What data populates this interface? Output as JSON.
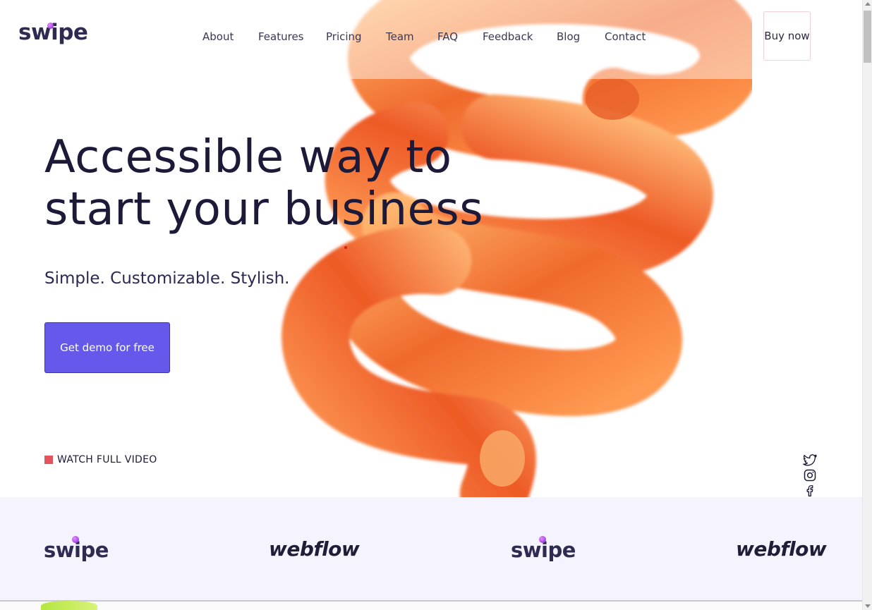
{
  "header": {
    "logo": "swipe",
    "nav": [
      "About",
      "Features",
      "Pricing",
      "Team",
      "FAQ",
      "Feedback",
      "Blog",
      "Contact"
    ],
    "buy_now": "Buy now"
  },
  "hero": {
    "headline_line1": "Accessible way to",
    "headline_line2": "start your business",
    "subtitle": "Simple. Customizable. Stylish.",
    "cta_label": "Get demo for free",
    "watch_video": "WATCH FULL VIDEO"
  },
  "social": [
    "twitter-icon",
    "instagram-icon",
    "facebook-icon"
  ],
  "logo_strip": [
    "swipe",
    "webflow",
    "swipe",
    "webflow"
  ],
  "colors": {
    "accent": "#6459ea",
    "text_dark": "#1c1a38",
    "spiral_orange": "#f0732c",
    "strip_bg": "#f5f3fd",
    "video_marker": "#e2555c"
  }
}
